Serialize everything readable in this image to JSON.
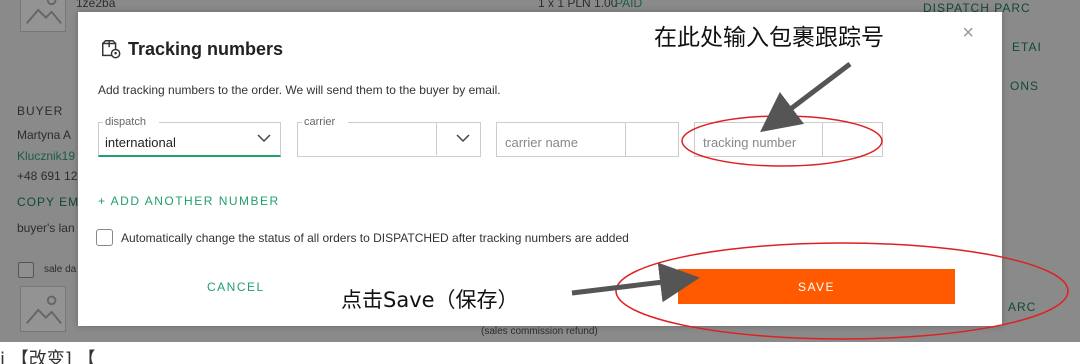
{
  "background": {
    "top_item_name": "1ze2ba",
    "top_item_price": "1 x 1 PLN 1.00",
    "top_item_status": "PAID",
    "buyer_heading": "BUYER",
    "buyer_name": "Martyna A",
    "buyer_login": "Klucznik19",
    "buyer_phone": "+48 691 12",
    "copy_email": "COPY EM",
    "buyer_lang": "buyer's lan",
    "sale_date": "sale da",
    "right_link_1": "DISPATCH PARC",
    "right_link_2": "ETAI",
    "right_link_3": "ONS",
    "right_link_4": "ARC",
    "bottom_note": "(sales commission refund)"
  },
  "modal": {
    "title": "Tracking numbers",
    "close_glyph": "×",
    "description": "Add tracking numbers to the order. We will send them to the buyer by email.",
    "dispatch_legend": "dispatch",
    "dispatch_value": "international",
    "carrier_legend": "carrier",
    "carrier_value": "",
    "carrier_name_placeholder": "carrier name",
    "tracking_number_placeholder": "tracking number",
    "add_another": "+ ADD ANOTHER NUMBER",
    "auto_status_label": "Automatically change the status of all orders to DISPATCHED after tracking numbers are added",
    "cancel_label": "CANCEL",
    "save_label": "SAVE"
  },
  "annotations": {
    "tracking_hint": "在此处输入包裹跟踪号",
    "save_hint": "点击Save（保存）",
    "bottom_partial": "i        【改变]        【",
    "color": "#e02020"
  },
  "colors": {
    "accent_green": "#22a06b",
    "save_orange": "#ff5a00"
  }
}
